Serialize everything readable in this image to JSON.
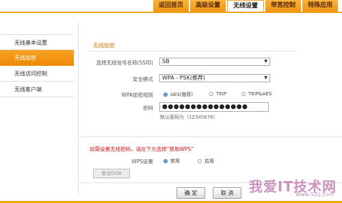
{
  "top_tabs": [
    {
      "label": "返回首页",
      "active": false
    },
    {
      "label": "高级设置",
      "active": false
    },
    {
      "label": "无线设置",
      "active": true
    },
    {
      "label": "带宽控制",
      "active": false
    },
    {
      "label": "特殊应用",
      "active": false
    }
  ],
  "sidebar": {
    "items": [
      {
        "label": "无线基本设置",
        "active": false
      },
      {
        "label": "无线加密",
        "active": true
      },
      {
        "label": "无线访问控制",
        "active": false
      },
      {
        "label": "无线客户端",
        "active": false
      }
    ]
  },
  "form": {
    "section_title": "无线加密",
    "ssid_label": "选择无线信号名称(SSID)",
    "ssid_value": "SB",
    "security_label": "安全模式",
    "security_value": "WPA - PSK(推荐)",
    "wpa_rule_label": "WPA加密规则",
    "wpa_options": [
      "AES(推荐)",
      "TKIP",
      "TKIP&AES"
    ],
    "wpa_selected": 0,
    "password_label": "密码",
    "password_masked": "●●●●●●●●●●●●●●●",
    "password_hint": "默认密码为（12345678）"
  },
  "wps": {
    "warning": "如需设置无线密码，请在下方选择“禁用WPS”",
    "label": "WPS设置",
    "options": [
      "禁用",
      "启用"
    ],
    "selected": 0,
    "reset_button": "重设OOB"
  },
  "actions": {
    "ok": "确 定",
    "cancel": "取 消"
  },
  "watermark": {
    "text": "我爱IT技术网",
    "url": "www.52ij.com"
  },
  "colors": {
    "accent": "#f3a11b",
    "warning": "#e01010",
    "section": "#e2760b"
  }
}
